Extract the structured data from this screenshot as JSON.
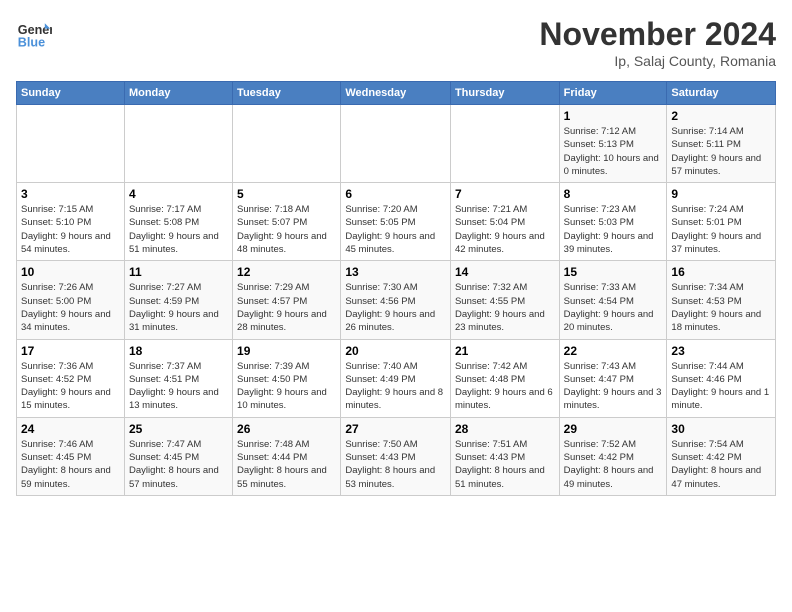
{
  "logo": {
    "line1": "General",
    "line2": "Blue"
  },
  "title": "November 2024",
  "subtitle": "Ip, Salaj County, Romania",
  "days_of_week": [
    "Sunday",
    "Monday",
    "Tuesday",
    "Wednesday",
    "Thursday",
    "Friday",
    "Saturday"
  ],
  "weeks": [
    [
      {
        "day": "",
        "info": ""
      },
      {
        "day": "",
        "info": ""
      },
      {
        "day": "",
        "info": ""
      },
      {
        "day": "",
        "info": ""
      },
      {
        "day": "",
        "info": ""
      },
      {
        "day": "1",
        "info": "Sunrise: 7:12 AM\nSunset: 5:13 PM\nDaylight: 10 hours and 0 minutes."
      },
      {
        "day": "2",
        "info": "Sunrise: 7:14 AM\nSunset: 5:11 PM\nDaylight: 9 hours and 57 minutes."
      }
    ],
    [
      {
        "day": "3",
        "info": "Sunrise: 7:15 AM\nSunset: 5:10 PM\nDaylight: 9 hours and 54 minutes."
      },
      {
        "day": "4",
        "info": "Sunrise: 7:17 AM\nSunset: 5:08 PM\nDaylight: 9 hours and 51 minutes."
      },
      {
        "day": "5",
        "info": "Sunrise: 7:18 AM\nSunset: 5:07 PM\nDaylight: 9 hours and 48 minutes."
      },
      {
        "day": "6",
        "info": "Sunrise: 7:20 AM\nSunset: 5:05 PM\nDaylight: 9 hours and 45 minutes."
      },
      {
        "day": "7",
        "info": "Sunrise: 7:21 AM\nSunset: 5:04 PM\nDaylight: 9 hours and 42 minutes."
      },
      {
        "day": "8",
        "info": "Sunrise: 7:23 AM\nSunset: 5:03 PM\nDaylight: 9 hours and 39 minutes."
      },
      {
        "day": "9",
        "info": "Sunrise: 7:24 AM\nSunset: 5:01 PM\nDaylight: 9 hours and 37 minutes."
      }
    ],
    [
      {
        "day": "10",
        "info": "Sunrise: 7:26 AM\nSunset: 5:00 PM\nDaylight: 9 hours and 34 minutes."
      },
      {
        "day": "11",
        "info": "Sunrise: 7:27 AM\nSunset: 4:59 PM\nDaylight: 9 hours and 31 minutes."
      },
      {
        "day": "12",
        "info": "Sunrise: 7:29 AM\nSunset: 4:57 PM\nDaylight: 9 hours and 28 minutes."
      },
      {
        "day": "13",
        "info": "Sunrise: 7:30 AM\nSunset: 4:56 PM\nDaylight: 9 hours and 26 minutes."
      },
      {
        "day": "14",
        "info": "Sunrise: 7:32 AM\nSunset: 4:55 PM\nDaylight: 9 hours and 23 minutes."
      },
      {
        "day": "15",
        "info": "Sunrise: 7:33 AM\nSunset: 4:54 PM\nDaylight: 9 hours and 20 minutes."
      },
      {
        "day": "16",
        "info": "Sunrise: 7:34 AM\nSunset: 4:53 PM\nDaylight: 9 hours and 18 minutes."
      }
    ],
    [
      {
        "day": "17",
        "info": "Sunrise: 7:36 AM\nSunset: 4:52 PM\nDaylight: 9 hours and 15 minutes."
      },
      {
        "day": "18",
        "info": "Sunrise: 7:37 AM\nSunset: 4:51 PM\nDaylight: 9 hours and 13 minutes."
      },
      {
        "day": "19",
        "info": "Sunrise: 7:39 AM\nSunset: 4:50 PM\nDaylight: 9 hours and 10 minutes."
      },
      {
        "day": "20",
        "info": "Sunrise: 7:40 AM\nSunset: 4:49 PM\nDaylight: 9 hours and 8 minutes."
      },
      {
        "day": "21",
        "info": "Sunrise: 7:42 AM\nSunset: 4:48 PM\nDaylight: 9 hours and 6 minutes."
      },
      {
        "day": "22",
        "info": "Sunrise: 7:43 AM\nSunset: 4:47 PM\nDaylight: 9 hours and 3 minutes."
      },
      {
        "day": "23",
        "info": "Sunrise: 7:44 AM\nSunset: 4:46 PM\nDaylight: 9 hours and 1 minute."
      }
    ],
    [
      {
        "day": "24",
        "info": "Sunrise: 7:46 AM\nSunset: 4:45 PM\nDaylight: 8 hours and 59 minutes."
      },
      {
        "day": "25",
        "info": "Sunrise: 7:47 AM\nSunset: 4:45 PM\nDaylight: 8 hours and 57 minutes."
      },
      {
        "day": "26",
        "info": "Sunrise: 7:48 AM\nSunset: 4:44 PM\nDaylight: 8 hours and 55 minutes."
      },
      {
        "day": "27",
        "info": "Sunrise: 7:50 AM\nSunset: 4:43 PM\nDaylight: 8 hours and 53 minutes."
      },
      {
        "day": "28",
        "info": "Sunrise: 7:51 AM\nSunset: 4:43 PM\nDaylight: 8 hours and 51 minutes."
      },
      {
        "day": "29",
        "info": "Sunrise: 7:52 AM\nSunset: 4:42 PM\nDaylight: 8 hours and 49 minutes."
      },
      {
        "day": "30",
        "info": "Sunrise: 7:54 AM\nSunset: 4:42 PM\nDaylight: 8 hours and 47 minutes."
      }
    ]
  ]
}
